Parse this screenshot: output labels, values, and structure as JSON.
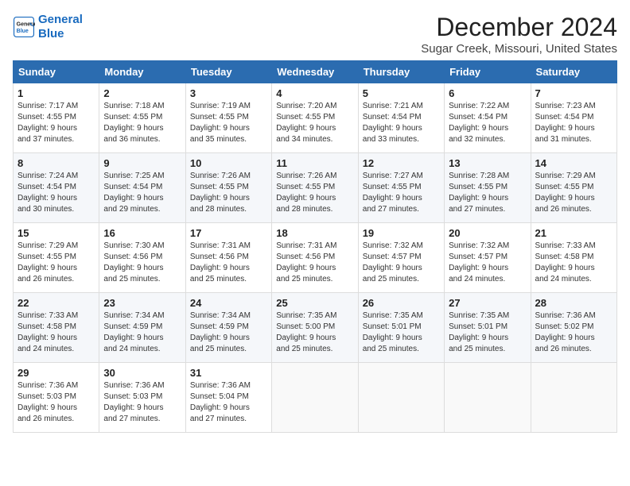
{
  "header": {
    "logo_line1": "General",
    "logo_line2": "Blue",
    "month": "December 2024",
    "location": "Sugar Creek, Missouri, United States"
  },
  "weekdays": [
    "Sunday",
    "Monday",
    "Tuesday",
    "Wednesday",
    "Thursday",
    "Friday",
    "Saturday"
  ],
  "weeks": [
    [
      {
        "day": "1",
        "info": "Sunrise: 7:17 AM\nSunset: 4:55 PM\nDaylight: 9 hours\nand 37 minutes."
      },
      {
        "day": "2",
        "info": "Sunrise: 7:18 AM\nSunset: 4:55 PM\nDaylight: 9 hours\nand 36 minutes."
      },
      {
        "day": "3",
        "info": "Sunrise: 7:19 AM\nSunset: 4:55 PM\nDaylight: 9 hours\nand 35 minutes."
      },
      {
        "day": "4",
        "info": "Sunrise: 7:20 AM\nSunset: 4:55 PM\nDaylight: 9 hours\nand 34 minutes."
      },
      {
        "day": "5",
        "info": "Sunrise: 7:21 AM\nSunset: 4:54 PM\nDaylight: 9 hours\nand 33 minutes."
      },
      {
        "day": "6",
        "info": "Sunrise: 7:22 AM\nSunset: 4:54 PM\nDaylight: 9 hours\nand 32 minutes."
      },
      {
        "day": "7",
        "info": "Sunrise: 7:23 AM\nSunset: 4:54 PM\nDaylight: 9 hours\nand 31 minutes."
      }
    ],
    [
      {
        "day": "8",
        "info": "Sunrise: 7:24 AM\nSunset: 4:54 PM\nDaylight: 9 hours\nand 30 minutes."
      },
      {
        "day": "9",
        "info": "Sunrise: 7:25 AM\nSunset: 4:54 PM\nDaylight: 9 hours\nand 29 minutes."
      },
      {
        "day": "10",
        "info": "Sunrise: 7:26 AM\nSunset: 4:55 PM\nDaylight: 9 hours\nand 28 minutes."
      },
      {
        "day": "11",
        "info": "Sunrise: 7:26 AM\nSunset: 4:55 PM\nDaylight: 9 hours\nand 28 minutes."
      },
      {
        "day": "12",
        "info": "Sunrise: 7:27 AM\nSunset: 4:55 PM\nDaylight: 9 hours\nand 27 minutes."
      },
      {
        "day": "13",
        "info": "Sunrise: 7:28 AM\nSunset: 4:55 PM\nDaylight: 9 hours\nand 27 minutes."
      },
      {
        "day": "14",
        "info": "Sunrise: 7:29 AM\nSunset: 4:55 PM\nDaylight: 9 hours\nand 26 minutes."
      }
    ],
    [
      {
        "day": "15",
        "info": "Sunrise: 7:29 AM\nSunset: 4:55 PM\nDaylight: 9 hours\nand 26 minutes."
      },
      {
        "day": "16",
        "info": "Sunrise: 7:30 AM\nSunset: 4:56 PM\nDaylight: 9 hours\nand 25 minutes."
      },
      {
        "day": "17",
        "info": "Sunrise: 7:31 AM\nSunset: 4:56 PM\nDaylight: 9 hours\nand 25 minutes."
      },
      {
        "day": "18",
        "info": "Sunrise: 7:31 AM\nSunset: 4:56 PM\nDaylight: 9 hours\nand 25 minutes."
      },
      {
        "day": "19",
        "info": "Sunrise: 7:32 AM\nSunset: 4:57 PM\nDaylight: 9 hours\nand 25 minutes."
      },
      {
        "day": "20",
        "info": "Sunrise: 7:32 AM\nSunset: 4:57 PM\nDaylight: 9 hours\nand 24 minutes."
      },
      {
        "day": "21",
        "info": "Sunrise: 7:33 AM\nSunset: 4:58 PM\nDaylight: 9 hours\nand 24 minutes."
      }
    ],
    [
      {
        "day": "22",
        "info": "Sunrise: 7:33 AM\nSunset: 4:58 PM\nDaylight: 9 hours\nand 24 minutes."
      },
      {
        "day": "23",
        "info": "Sunrise: 7:34 AM\nSunset: 4:59 PM\nDaylight: 9 hours\nand 24 minutes."
      },
      {
        "day": "24",
        "info": "Sunrise: 7:34 AM\nSunset: 4:59 PM\nDaylight: 9 hours\nand 25 minutes."
      },
      {
        "day": "25",
        "info": "Sunrise: 7:35 AM\nSunset: 5:00 PM\nDaylight: 9 hours\nand 25 minutes."
      },
      {
        "day": "26",
        "info": "Sunrise: 7:35 AM\nSunset: 5:01 PM\nDaylight: 9 hours\nand 25 minutes."
      },
      {
        "day": "27",
        "info": "Sunrise: 7:35 AM\nSunset: 5:01 PM\nDaylight: 9 hours\nand 25 minutes."
      },
      {
        "day": "28",
        "info": "Sunrise: 7:36 AM\nSunset: 5:02 PM\nDaylight: 9 hours\nand 26 minutes."
      }
    ],
    [
      {
        "day": "29",
        "info": "Sunrise: 7:36 AM\nSunset: 5:03 PM\nDaylight: 9 hours\nand 26 minutes."
      },
      {
        "day": "30",
        "info": "Sunrise: 7:36 AM\nSunset: 5:03 PM\nDaylight: 9 hours\nand 27 minutes."
      },
      {
        "day": "31",
        "info": "Sunrise: 7:36 AM\nSunset: 5:04 PM\nDaylight: 9 hours\nand 27 minutes."
      },
      null,
      null,
      null,
      null
    ]
  ]
}
